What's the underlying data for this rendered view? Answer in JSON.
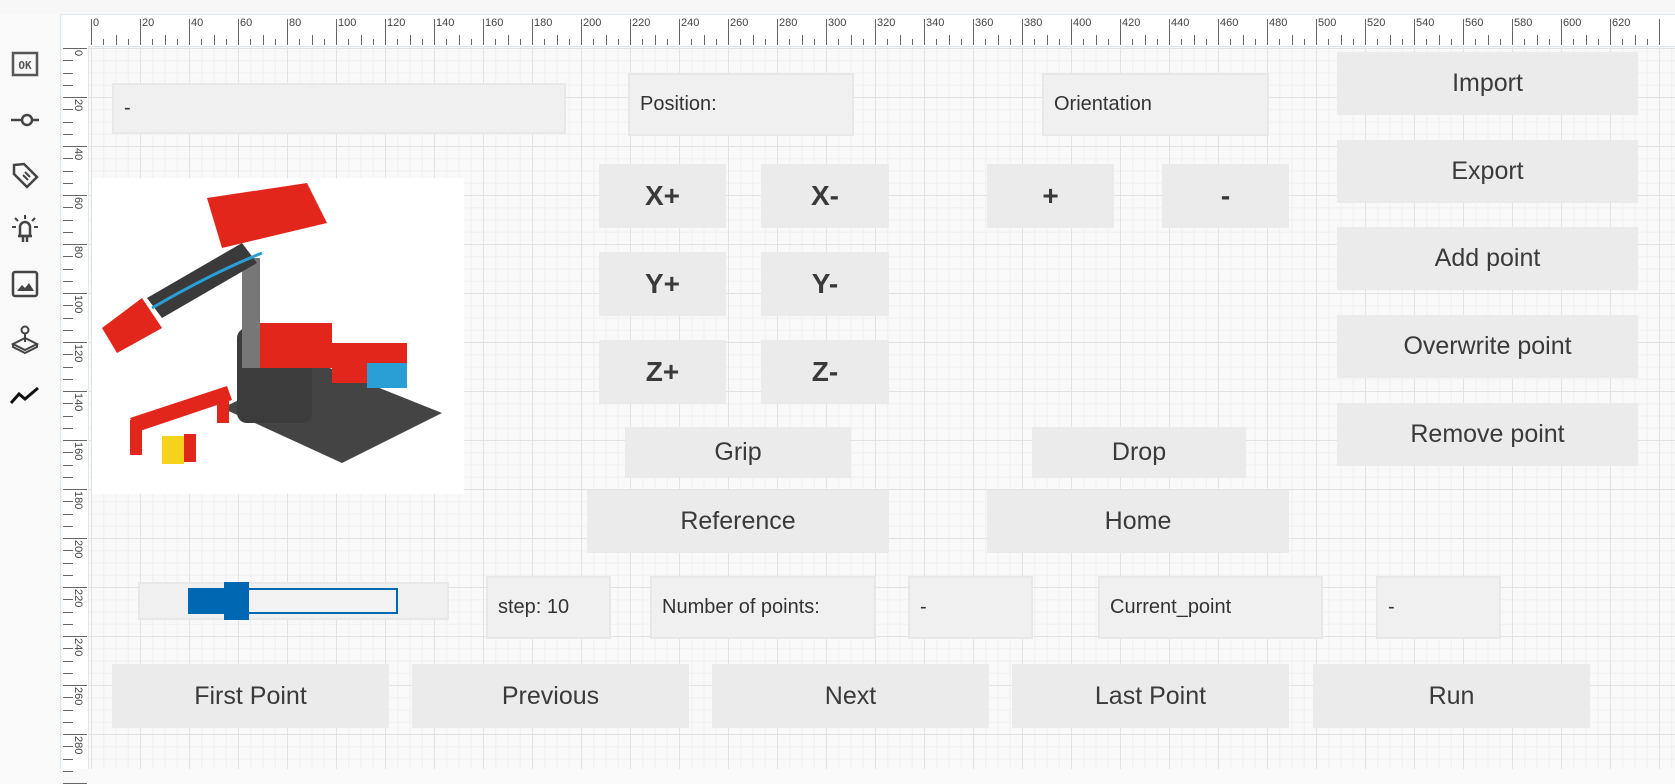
{
  "sidebar": {
    "icons": [
      "ok-button-icon",
      "slider-icon",
      "tag-icon",
      "light-icon",
      "image-icon",
      "joystick-icon",
      "chart-line-icon"
    ]
  },
  "ruler": {
    "top_labels": [
      "0",
      "20",
      "40",
      "60",
      "80",
      "100",
      "120",
      "140",
      "160",
      "180",
      "200",
      "220",
      "240",
      "260",
      "280",
      "300",
      "320",
      "340",
      "360",
      "380",
      "400",
      "420",
      "440",
      "460",
      "480",
      "500",
      "520",
      "540",
      "560",
      "580",
      "600",
      "620"
    ],
    "left_labels": [
      "0",
      "20",
      "40",
      "60",
      "80",
      "100",
      "120",
      "140",
      "160",
      "180",
      "200",
      "220",
      "240",
      "260",
      "280"
    ]
  },
  "main": {
    "status_text": "-",
    "position_label": "Position:",
    "orientation_label": "Orientation",
    "buttons": {
      "import": "Import",
      "export": "Export",
      "add_point": "Add point",
      "overwrite_point": "Overwrite point",
      "remove_point": "Remove point",
      "x_plus": "X+",
      "x_minus": "X-",
      "y_plus": "Y+",
      "y_minus": "Y-",
      "z_plus": "Z+",
      "z_minus": "Z-",
      "orient_plus": "+",
      "orient_minus": "-",
      "grip": "Grip",
      "drop": "Drop",
      "reference": "Reference",
      "home": "Home",
      "first_point": "First Point",
      "previous": "Previous",
      "next": "Next",
      "last_point": "Last Point",
      "run": "Run"
    },
    "step_label": "step: 10",
    "slider_fraction": 0.23,
    "slider_color": "#0067b3",
    "number_of_points_label": "Number of points:",
    "number_of_points_value": "-",
    "current_point_label": "Current_point",
    "current_point_value": "-"
  }
}
